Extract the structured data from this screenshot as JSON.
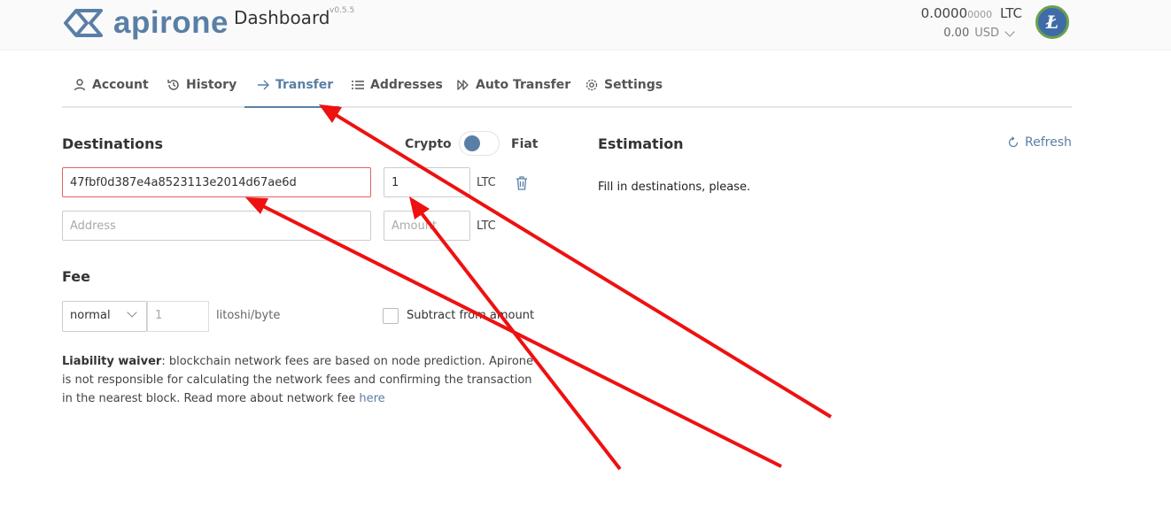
{
  "header": {
    "logo_text": "apirone",
    "title": "Dashboard",
    "version": "v0.5.5",
    "balance_main": "0.0000",
    "balance_small": "0000",
    "balance_currency": "LTC",
    "fiat_amount": "0.00",
    "fiat_currency": "USD",
    "coin_symbol": "Ł",
    "colors": {
      "brand": "#5a7fa6",
      "coin_bg": "#3f6ca8",
      "coin_ring": "#6aa04d"
    }
  },
  "tabs": [
    {
      "label": "Account",
      "icon": "user-icon"
    },
    {
      "label": "History",
      "icon": "history-icon"
    },
    {
      "label": "Transfer",
      "icon": "arrow-right-icon",
      "active": true
    },
    {
      "label": "Addresses",
      "icon": "list-icon"
    },
    {
      "label": "Auto Transfer",
      "icon": "fast-forward-icon"
    },
    {
      "label": "Settings",
      "icon": "gear-icon"
    }
  ],
  "destinations": {
    "heading": "Destinations",
    "crypto_label": "Crypto",
    "fiat_label": "Fiat",
    "rows": [
      {
        "address_value": "47fbf0d387e4a8523113e2014d67ae6d",
        "amount_value": "1",
        "unit": "LTC"
      },
      {
        "address_placeholder": "Address",
        "amount_placeholder": "Amount",
        "unit": "LTC"
      }
    ]
  },
  "estimation": {
    "heading": "Estimation",
    "refresh_label": "Refresh",
    "message": "Fill in destinations, please."
  },
  "fee": {
    "heading": "Fee",
    "select_value": "normal",
    "rate_placeholder": "1",
    "rate_unit": "litoshi/byte",
    "subtract_label": "Subtract from amount"
  },
  "waiver": {
    "bold": "Liability waiver",
    "text": ": blockchain network fees are based on node prediction. Apirone is not responsible for calculating the network fees and confirming the transaction in the nearest block. Read more about network fee ",
    "link": "here"
  },
  "annotation_color": "#ee1111"
}
